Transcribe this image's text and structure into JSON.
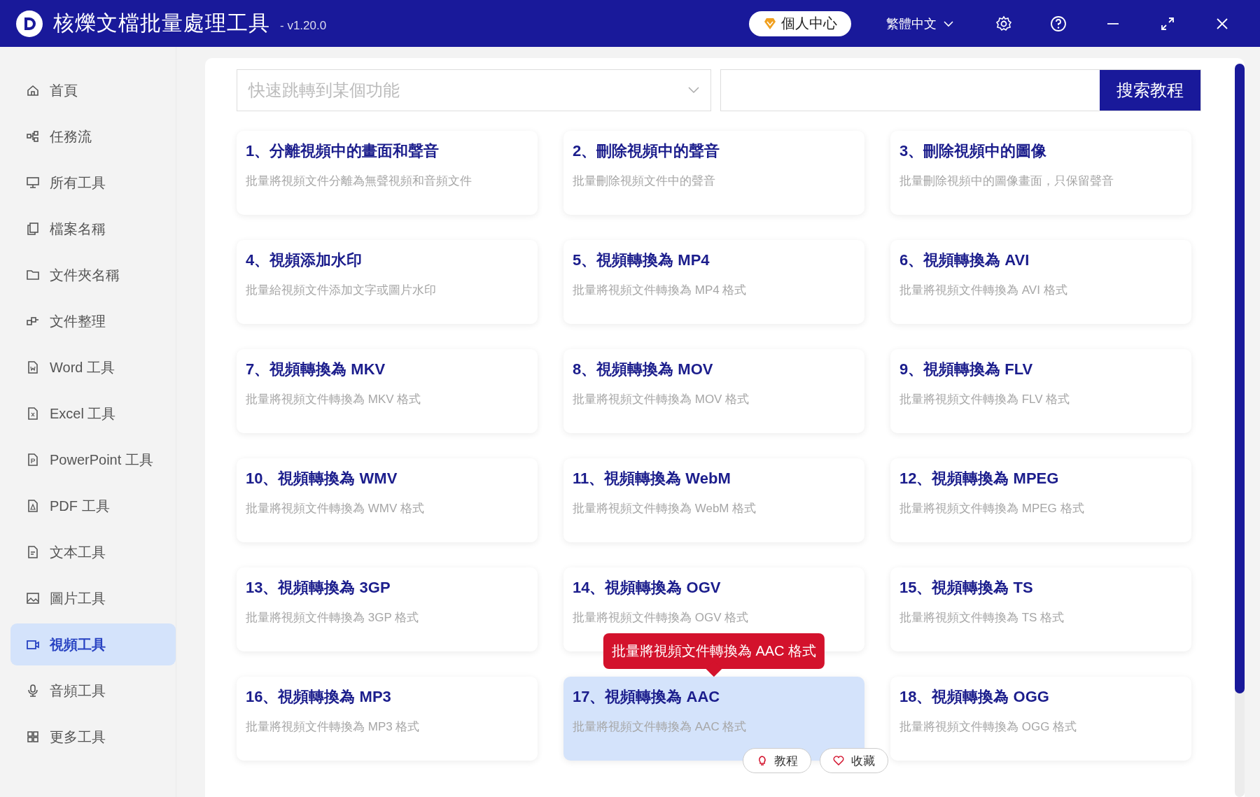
{
  "window": {
    "title": "核爍文檔批量處理工具",
    "version": "- v1.20.0",
    "user_button": "個人中心",
    "language": "繁體中文"
  },
  "sidebar": {
    "items": [
      {
        "label": "首頁",
        "selected": false
      },
      {
        "label": "任務流",
        "selected": false
      },
      {
        "label": "所有工具",
        "selected": false
      },
      {
        "label": "檔案名稱",
        "selected": false
      },
      {
        "label": "文件夾名稱",
        "selected": false
      },
      {
        "label": "文件整理",
        "selected": false
      },
      {
        "label": "Word 工具",
        "selected": false
      },
      {
        "label": "Excel 工具",
        "selected": false
      },
      {
        "label": "PowerPoint 工具",
        "selected": false
      },
      {
        "label": "PDF 工具",
        "selected": false
      },
      {
        "label": "文本工具",
        "selected": false
      },
      {
        "label": "圖片工具",
        "selected": false
      },
      {
        "label": "視頻工具",
        "selected": true
      },
      {
        "label": "音頻工具",
        "selected": false
      },
      {
        "label": "更多工具",
        "selected": false
      }
    ]
  },
  "search": {
    "jump_placeholder": "快速跳轉到某個功能",
    "button": "搜索教程"
  },
  "cards": [
    {
      "title": "1、分離視頻中的畫面和聲音",
      "description": "批量將視頻文件分離為無聲視頻和音頻文件",
      "selected": false
    },
    {
      "title": "2、刪除視頻中的聲音",
      "description": "批量刪除視頻文件中的聲音",
      "selected": false
    },
    {
      "title": "3、刪除視頻中的圖像",
      "description": "批量刪除視頻中的圖像畫面，只保留聲音",
      "selected": false
    },
    {
      "title": "4、視頻添加水印",
      "description": "批量給視頻文件添加文字或圖片水印",
      "selected": false
    },
    {
      "title": "5、視頻轉換為 MP4",
      "description": "批量將視頻文件轉換為 MP4 格式",
      "selected": false
    },
    {
      "title": "6、視頻轉換為 AVI",
      "description": "批量將視頻文件轉換為 AVI 格式",
      "selected": false
    },
    {
      "title": "7、視頻轉換為 MKV",
      "description": "批量將視頻文件轉換為 MKV 格式",
      "selected": false
    },
    {
      "title": "8、視頻轉換為 MOV",
      "description": "批量將視頻文件轉換為 MOV 格式",
      "selected": false
    },
    {
      "title": "9、視頻轉換為 FLV",
      "description": "批量將視頻文件轉換為 FLV 格式",
      "selected": false
    },
    {
      "title": "10、視頻轉換為 WMV",
      "description": "批量將視頻文件轉換為 WMV 格式",
      "selected": false
    },
    {
      "title": "11、視頻轉換為 WebM",
      "description": "批量將視頻文件轉換為 WebM 格式",
      "selected": false
    },
    {
      "title": "12、視頻轉換為 MPEG",
      "description": "批量將視頻文件轉換為 MPEG 格式",
      "selected": false
    },
    {
      "title": "13、視頻轉換為 3GP",
      "description": "批量將視頻文件轉換為 3GP 格式",
      "selected": false
    },
    {
      "title": "14、視頻轉換為 OGV",
      "description": "批量將視頻文件轉換為 OGV 格式",
      "selected": false
    },
    {
      "title": "15、視頻轉換為 TS",
      "description": "批量將視頻文件轉換為 TS 格式",
      "selected": false
    },
    {
      "title": "16、視頻轉換為 MP3",
      "description": "批量將視頻文件轉換為 MP3 格式",
      "selected": false
    },
    {
      "title": "17、視頻轉換為 AAC",
      "description": "批量將視頻文件轉換為 AAC 格式",
      "selected": true
    },
    {
      "title": "18、視頻轉換為 OGG",
      "description": "批量將視頻文件轉換為 OGG 格式",
      "selected": false
    }
  ],
  "hover_popup": {
    "tooltip": "批量將視頻文件轉換為 AAC 格式",
    "actions": [
      "教程",
      "收藏"
    ]
  }
}
